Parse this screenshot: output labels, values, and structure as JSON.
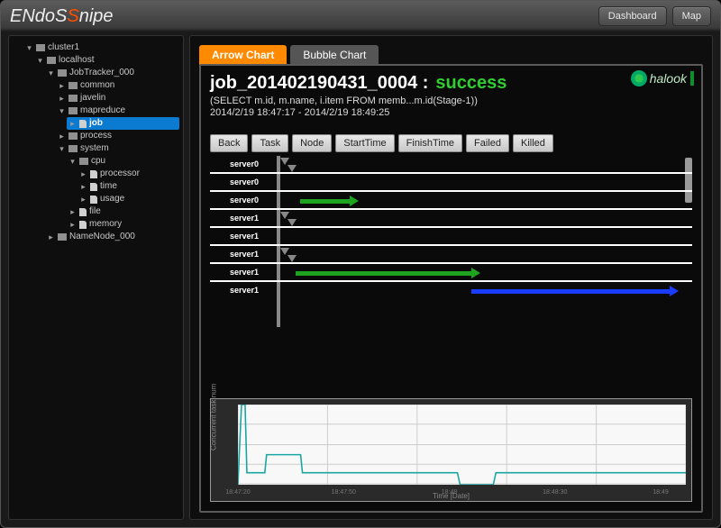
{
  "app": {
    "name_pre": "EN",
    "name_mid": "doS",
    "name_post": "nipe"
  },
  "topbar": {
    "dashboard": "Dashboard",
    "map": "Map"
  },
  "tree": {
    "root": "cluster1",
    "localhost": "localhost",
    "jobtracker": "JobTracker_000",
    "common": "common",
    "javelin": "javelin",
    "mapreduce": "mapreduce",
    "job": "job",
    "process": "process",
    "system": "system",
    "cpu": "cpu",
    "processor": "processor",
    "time": "time",
    "usage": "usage",
    "file": "file",
    "memory": "memory",
    "namenode": "NameNode_000"
  },
  "tabs": {
    "arrow": "Arrow Chart",
    "bubble": "Bubble Chart"
  },
  "branding": "halook",
  "job": {
    "title": "job_201402190431_0004 :",
    "status": "success",
    "query": "(SELECT m.id, m.name, i.item FROM memb...m.id(Stage-1))",
    "timerange": "2014/2/19 18:47:17 - 2014/2/19 18:49:25"
  },
  "toolbar": {
    "back": "Back",
    "task": "Task",
    "node": "Node",
    "start": "StartTime",
    "finish": "FinishTime",
    "failed": "Failed",
    "killed": "Killed"
  },
  "chart_data": {
    "arrow": {
      "type": "gantt-arrow",
      "rows": [
        {
          "server": "server0",
          "arrow": null,
          "markers": 2
        },
        {
          "server": "server0",
          "arrow": null,
          "markers": 0
        },
        {
          "server": "server0",
          "arrow": {
            "start": 100,
            "end": 165,
            "color": "#1ea31e"
          },
          "markers": 0
        },
        {
          "server": "server1",
          "arrow": null,
          "markers": 2
        },
        {
          "server": "server1",
          "arrow": null,
          "markers": 0
        },
        {
          "server": "server1",
          "arrow": null,
          "markers": 2
        },
        {
          "server": "server1",
          "arrow": {
            "start": 95,
            "end": 300,
            "color": "#1ea31e"
          },
          "markers": 0
        },
        {
          "server": "server1",
          "arrow": {
            "start": 290,
            "end": 520,
            "color": "#1a3cff"
          },
          "markers": 0
        }
      ]
    },
    "line": {
      "type": "line",
      "ylabel": "Concurrent task num",
      "xlabel": "Time [Date]",
      "x_ticks": [
        "18:47:20",
        "18:47:50",
        "18:48",
        "18:48:30",
        "18:49"
      ],
      "ylim": [
        0,
        4
      ],
      "points": [
        [
          0,
          0
        ],
        [
          4,
          4
        ],
        [
          8,
          4
        ],
        [
          10,
          0.6
        ],
        [
          30,
          0.6
        ],
        [
          32,
          1.5
        ],
        [
          70,
          1.5
        ],
        [
          72,
          0.6
        ],
        [
          245,
          0.6
        ],
        [
          248,
          0
        ],
        [
          285,
          0
        ],
        [
          288,
          0.6
        ],
        [
          500,
          0.6
        ]
      ]
    }
  }
}
